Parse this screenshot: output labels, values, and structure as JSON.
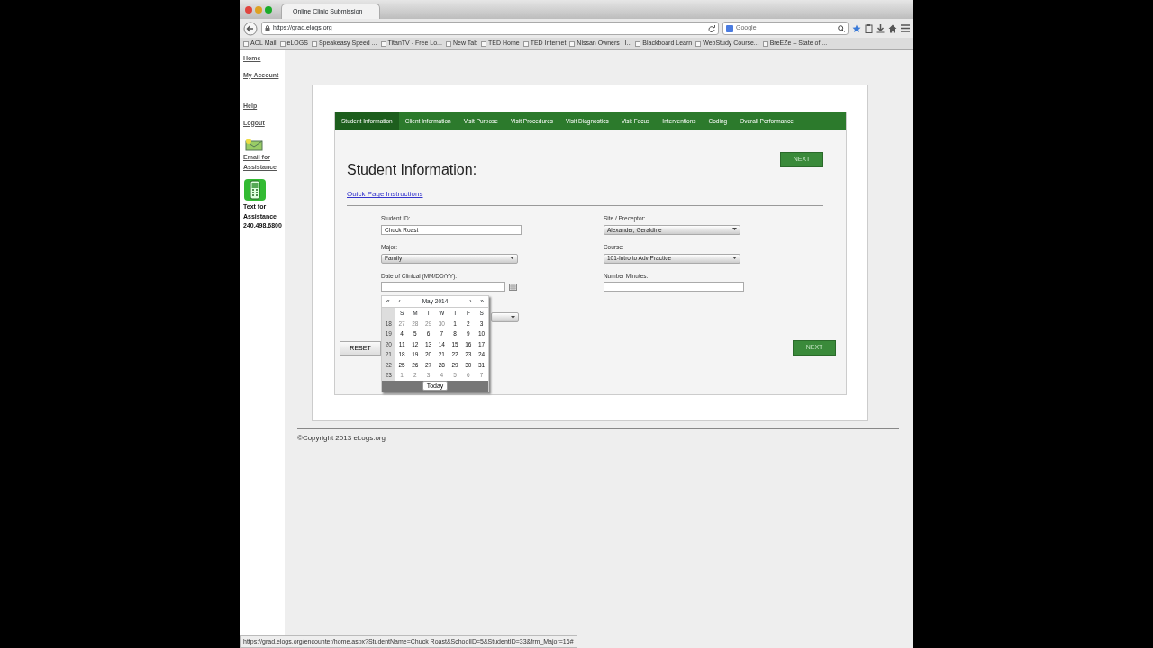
{
  "browser": {
    "tab_title": "Online Clinic Submission",
    "url": "https://grad.elogs.org",
    "search_placeholder": "Google",
    "bookmarks": [
      "AOL Mail",
      "eLOGS",
      "Speakeasy Speed ...",
      "TitanTV - Free Lo...",
      "New Tab",
      "TED Home",
      "TED Internet",
      "Nissan Owners | I...",
      "Blackboard Learn",
      "WebStudy Course...",
      "BreEZe – State of ..."
    ],
    "status_url": "https://grad.elogs.org/encounter/home.aspx?StudentName=Chuck  Roast&SchoolID=5&StudentID=33&frm_Major=16#"
  },
  "sidebar": {
    "links": [
      "Home",
      "My Account",
      "Help",
      "Logout"
    ],
    "email": "Email for Assistance",
    "text_help": [
      "Text for",
      "Assistance",
      "240.498.6800"
    ]
  },
  "tabs": [
    {
      "label": "Student Information",
      "selected": true
    },
    {
      "label": "Client Information",
      "selected": false
    },
    {
      "label": "Visit Purpose",
      "selected": false
    },
    {
      "label": "Visit Procedures",
      "selected": false
    },
    {
      "label": "Visit Diagnostics",
      "selected": false
    },
    {
      "label": "Visit Focus",
      "selected": false
    },
    {
      "label": "Interventions",
      "selected": false
    },
    {
      "label": "Coding",
      "selected": false
    },
    {
      "label": "Overall Performance",
      "selected": false
    }
  ],
  "heading": "Student Information:",
  "instructions_link": "Quick Page Instructions",
  "next_top_label": "NEXT",
  "next_bottom_label": "NEXT",
  "reset_label": "RESET",
  "fields": {
    "left": [
      {
        "kind": "text",
        "label": "Student ID:",
        "value": "Chuck  Roast"
      },
      {
        "kind": "select",
        "label": "Major:",
        "value": "Family"
      },
      {
        "kind": "date",
        "label": "Date of Clinical (MM/DD/YY):"
      }
    ],
    "right": [
      {
        "kind": "select",
        "label": "Site / Preceptor:",
        "value": "Alexander, Geraldine"
      },
      {
        "kind": "select",
        "label": "Course:",
        "value": "101-Intro to Adv Practice"
      },
      {
        "kind": "text",
        "label": "Number Minutes:"
      }
    ]
  },
  "calendar": {
    "nav": [
      "«",
      "‹",
      "›",
      "»"
    ],
    "month": "May 2014",
    "weekdays": [
      "S",
      "M",
      "T",
      "W",
      "T",
      "F",
      "S"
    ],
    "today_label": "Today",
    "weeks": [
      {
        "week": "18",
        "days": [
          {
            "d": "27",
            "outside": true
          },
          {
            "d": "28",
            "outside": true
          },
          {
            "d": "29",
            "outside": true
          },
          {
            "d": "30",
            "outside": true
          },
          {
            "d": "1",
            "outside": false
          },
          {
            "d": "2",
            "outside": false
          },
          {
            "d": "3",
            "outside": false
          }
        ]
      },
      {
        "week": "19",
        "days": [
          {
            "d": "4",
            "outside": false
          },
          {
            "d": "5",
            "outside": false
          },
          {
            "d": "6",
            "outside": false
          },
          {
            "d": "7",
            "outside": false
          },
          {
            "d": "8",
            "outside": false
          },
          {
            "d": "9",
            "outside": false
          },
          {
            "d": "10",
            "outside": false
          }
        ]
      },
      {
        "week": "20",
        "days": [
          {
            "d": "11",
            "outside": false
          },
          {
            "d": "12",
            "outside": false
          },
          {
            "d": "13",
            "outside": false
          },
          {
            "d": "14",
            "outside": false
          },
          {
            "d": "15",
            "outside": false
          },
          {
            "d": "16",
            "outside": false
          },
          {
            "d": "17",
            "outside": false
          }
        ]
      },
      {
        "week": "21",
        "days": [
          {
            "d": "18",
            "outside": false
          },
          {
            "d": "19",
            "outside": false
          },
          {
            "d": "20",
            "outside": false
          },
          {
            "d": "21",
            "outside": false
          },
          {
            "d": "22",
            "outside": false
          },
          {
            "d": "23",
            "outside": false
          },
          {
            "d": "24",
            "outside": false
          }
        ]
      },
      {
        "week": "22",
        "days": [
          {
            "d": "25",
            "outside": false
          },
          {
            "d": "26",
            "outside": false
          },
          {
            "d": "27",
            "outside": false
          },
          {
            "d": "28",
            "outside": false
          },
          {
            "d": "29",
            "outside": false
          },
          {
            "d": "30",
            "outside": false
          },
          {
            "d": "31",
            "outside": false
          }
        ]
      },
      {
        "week": "23",
        "days": [
          {
            "d": "1",
            "outside": true
          },
          {
            "d": "2",
            "outside": true
          },
          {
            "d": "3",
            "outside": true
          },
          {
            "d": "4",
            "outside": true
          },
          {
            "d": "5",
            "outside": true
          },
          {
            "d": "6",
            "outside": true
          },
          {
            "d": "7",
            "outside": true
          }
        ]
      }
    ]
  },
  "footer": "©Copyright 2013 eLogs.org"
}
